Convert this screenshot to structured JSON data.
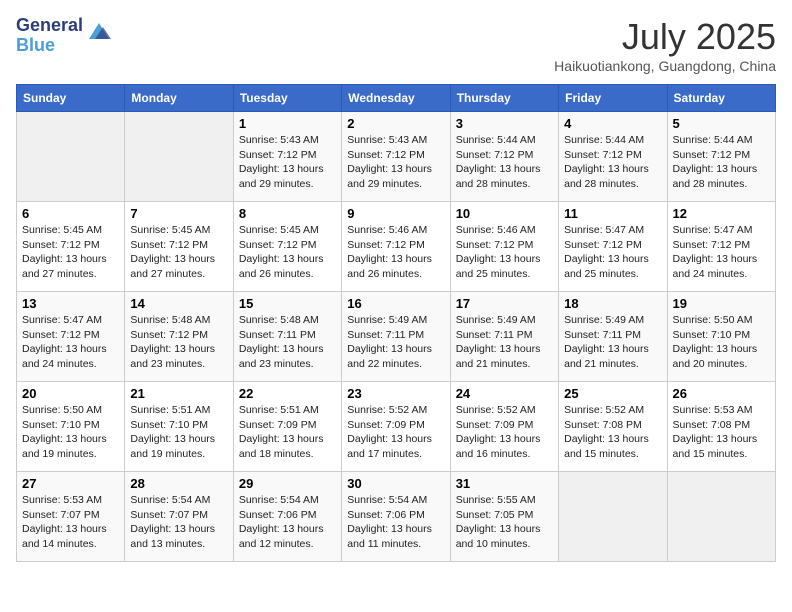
{
  "header": {
    "logo_line1": "General",
    "logo_line2": "Blue",
    "month_year": "July 2025",
    "location": "Haikuotiankong, Guangdong, China"
  },
  "days_of_week": [
    "Sunday",
    "Monday",
    "Tuesday",
    "Wednesday",
    "Thursday",
    "Friday",
    "Saturday"
  ],
  "weeks": [
    [
      {
        "day": "",
        "sunrise": "",
        "sunset": "",
        "daylight": ""
      },
      {
        "day": "",
        "sunrise": "",
        "sunset": "",
        "daylight": ""
      },
      {
        "day": "1",
        "sunrise": "Sunrise: 5:43 AM",
        "sunset": "Sunset: 7:12 PM",
        "daylight": "Daylight: 13 hours and 29 minutes."
      },
      {
        "day": "2",
        "sunrise": "Sunrise: 5:43 AM",
        "sunset": "Sunset: 7:12 PM",
        "daylight": "Daylight: 13 hours and 29 minutes."
      },
      {
        "day": "3",
        "sunrise": "Sunrise: 5:44 AM",
        "sunset": "Sunset: 7:12 PM",
        "daylight": "Daylight: 13 hours and 28 minutes."
      },
      {
        "day": "4",
        "sunrise": "Sunrise: 5:44 AM",
        "sunset": "Sunset: 7:12 PM",
        "daylight": "Daylight: 13 hours and 28 minutes."
      },
      {
        "day": "5",
        "sunrise": "Sunrise: 5:44 AM",
        "sunset": "Sunset: 7:12 PM",
        "daylight": "Daylight: 13 hours and 28 minutes."
      }
    ],
    [
      {
        "day": "6",
        "sunrise": "Sunrise: 5:45 AM",
        "sunset": "Sunset: 7:12 PM",
        "daylight": "Daylight: 13 hours and 27 minutes."
      },
      {
        "day": "7",
        "sunrise": "Sunrise: 5:45 AM",
        "sunset": "Sunset: 7:12 PM",
        "daylight": "Daylight: 13 hours and 27 minutes."
      },
      {
        "day": "8",
        "sunrise": "Sunrise: 5:45 AM",
        "sunset": "Sunset: 7:12 PM",
        "daylight": "Daylight: 13 hours and 26 minutes."
      },
      {
        "day": "9",
        "sunrise": "Sunrise: 5:46 AM",
        "sunset": "Sunset: 7:12 PM",
        "daylight": "Daylight: 13 hours and 26 minutes."
      },
      {
        "day": "10",
        "sunrise": "Sunrise: 5:46 AM",
        "sunset": "Sunset: 7:12 PM",
        "daylight": "Daylight: 13 hours and 25 minutes."
      },
      {
        "day": "11",
        "sunrise": "Sunrise: 5:47 AM",
        "sunset": "Sunset: 7:12 PM",
        "daylight": "Daylight: 13 hours and 25 minutes."
      },
      {
        "day": "12",
        "sunrise": "Sunrise: 5:47 AM",
        "sunset": "Sunset: 7:12 PM",
        "daylight": "Daylight: 13 hours and 24 minutes."
      }
    ],
    [
      {
        "day": "13",
        "sunrise": "Sunrise: 5:47 AM",
        "sunset": "Sunset: 7:12 PM",
        "daylight": "Daylight: 13 hours and 24 minutes."
      },
      {
        "day": "14",
        "sunrise": "Sunrise: 5:48 AM",
        "sunset": "Sunset: 7:12 PM",
        "daylight": "Daylight: 13 hours and 23 minutes."
      },
      {
        "day": "15",
        "sunrise": "Sunrise: 5:48 AM",
        "sunset": "Sunset: 7:11 PM",
        "daylight": "Daylight: 13 hours and 23 minutes."
      },
      {
        "day": "16",
        "sunrise": "Sunrise: 5:49 AM",
        "sunset": "Sunset: 7:11 PM",
        "daylight": "Daylight: 13 hours and 22 minutes."
      },
      {
        "day": "17",
        "sunrise": "Sunrise: 5:49 AM",
        "sunset": "Sunset: 7:11 PM",
        "daylight": "Daylight: 13 hours and 21 minutes."
      },
      {
        "day": "18",
        "sunrise": "Sunrise: 5:49 AM",
        "sunset": "Sunset: 7:11 PM",
        "daylight": "Daylight: 13 hours and 21 minutes."
      },
      {
        "day": "19",
        "sunrise": "Sunrise: 5:50 AM",
        "sunset": "Sunset: 7:10 PM",
        "daylight": "Daylight: 13 hours and 20 minutes."
      }
    ],
    [
      {
        "day": "20",
        "sunrise": "Sunrise: 5:50 AM",
        "sunset": "Sunset: 7:10 PM",
        "daylight": "Daylight: 13 hours and 19 minutes."
      },
      {
        "day": "21",
        "sunrise": "Sunrise: 5:51 AM",
        "sunset": "Sunset: 7:10 PM",
        "daylight": "Daylight: 13 hours and 19 minutes."
      },
      {
        "day": "22",
        "sunrise": "Sunrise: 5:51 AM",
        "sunset": "Sunset: 7:09 PM",
        "daylight": "Daylight: 13 hours and 18 minutes."
      },
      {
        "day": "23",
        "sunrise": "Sunrise: 5:52 AM",
        "sunset": "Sunset: 7:09 PM",
        "daylight": "Daylight: 13 hours and 17 minutes."
      },
      {
        "day": "24",
        "sunrise": "Sunrise: 5:52 AM",
        "sunset": "Sunset: 7:09 PM",
        "daylight": "Daylight: 13 hours and 16 minutes."
      },
      {
        "day": "25",
        "sunrise": "Sunrise: 5:52 AM",
        "sunset": "Sunset: 7:08 PM",
        "daylight": "Daylight: 13 hours and 15 minutes."
      },
      {
        "day": "26",
        "sunrise": "Sunrise: 5:53 AM",
        "sunset": "Sunset: 7:08 PM",
        "daylight": "Daylight: 13 hours and 15 minutes."
      }
    ],
    [
      {
        "day": "27",
        "sunrise": "Sunrise: 5:53 AM",
        "sunset": "Sunset: 7:07 PM",
        "daylight": "Daylight: 13 hours and 14 minutes."
      },
      {
        "day": "28",
        "sunrise": "Sunrise: 5:54 AM",
        "sunset": "Sunset: 7:07 PM",
        "daylight": "Daylight: 13 hours and 13 minutes."
      },
      {
        "day": "29",
        "sunrise": "Sunrise: 5:54 AM",
        "sunset": "Sunset: 7:06 PM",
        "daylight": "Daylight: 13 hours and 12 minutes."
      },
      {
        "day": "30",
        "sunrise": "Sunrise: 5:54 AM",
        "sunset": "Sunset: 7:06 PM",
        "daylight": "Daylight: 13 hours and 11 minutes."
      },
      {
        "day": "31",
        "sunrise": "Sunrise: 5:55 AM",
        "sunset": "Sunset: 7:05 PM",
        "daylight": "Daylight: 13 hours and 10 minutes."
      },
      {
        "day": "",
        "sunrise": "",
        "sunset": "",
        "daylight": ""
      },
      {
        "day": "",
        "sunrise": "",
        "sunset": "",
        "daylight": ""
      }
    ]
  ]
}
